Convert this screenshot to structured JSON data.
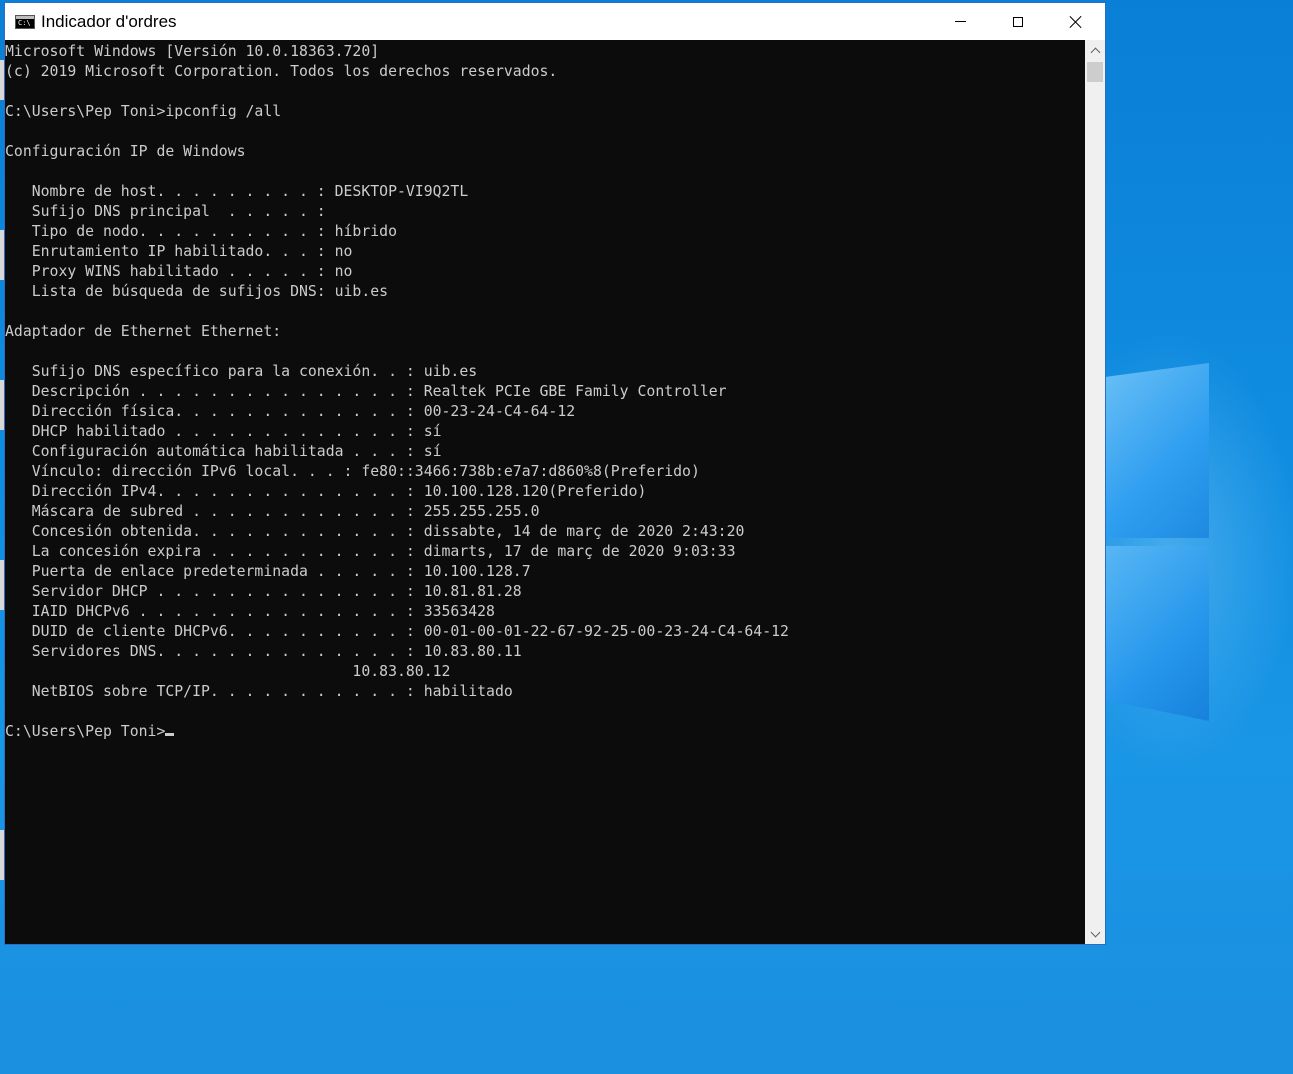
{
  "window": {
    "title": "Indicador d'ordres"
  },
  "console": {
    "lines": [
      "Microsoft Windows [Versión 10.0.18363.720]",
      "(c) 2019 Microsoft Corporation. Todos los derechos reservados.",
      "",
      "C:\\Users\\Pep Toni>ipconfig /all",
      "",
      "Configuración IP de Windows",
      "",
      "   Nombre de host. . . . . . . . . : DESKTOP-VI9Q2TL",
      "   Sufijo DNS principal  . . . . . :",
      "   Tipo de nodo. . . . . . . . . . : híbrido",
      "   Enrutamiento IP habilitado. . . : no",
      "   Proxy WINS habilitado . . . . . : no",
      "   Lista de búsqueda de sufijos DNS: uib.es",
      "",
      "Adaptador de Ethernet Ethernet:",
      "",
      "   Sufijo DNS específico para la conexión. . : uib.es",
      "   Descripción . . . . . . . . . . . . . . . : Realtek PCIe GBE Family Controller",
      "   Dirección física. . . . . . . . . . . . . : 00-23-24-C4-64-12",
      "   DHCP habilitado . . . . . . . . . . . . . : sí",
      "   Configuración automática habilitada . . . : sí",
      "   Vínculo: dirección IPv6 local. . . : fe80::3466:738b:e7a7:d860%8(Preferido)",
      "   Dirección IPv4. . . . . . . . . . . . . . : 10.100.128.120(Preferido)",
      "   Máscara de subred . . . . . . . . . . . . : 255.255.255.0",
      "   Concesión obtenida. . . . . . . . . . . . : dissabte, 14 de març de 2020 2:43:20",
      "   La concesión expira . . . . . . . . . . . : dimarts, 17 de març de 2020 9:03:33",
      "   Puerta de enlace predeterminada . . . . . : 10.100.128.7",
      "   Servidor DHCP . . . . . . . . . . . . . . : 10.81.81.28",
      "   IAID DHCPv6 . . . . . . . . . . . . . . . : 33563428",
      "   DUID de cliente DHCPv6. . . . . . . . . . : 00-01-00-01-22-67-92-25-00-23-24-C4-64-12",
      "   Servidores DNS. . . . . . . . . . . . . . : 10.83.80.11",
      "                                       10.83.80.12",
      "   NetBIOS sobre TCP/IP. . . . . . . . . . . : habilitado",
      "",
      "C:\\Users\\Pep Toni>"
    ]
  },
  "icons": {
    "app": "cmd-icon",
    "minimize": "minimize-icon",
    "maximize": "maximize-icon",
    "close": "close-icon",
    "scroll_up": "chevron-up-icon",
    "scroll_down": "chevron-down-icon"
  },
  "colors": {
    "console_bg": "#0c0c0c",
    "console_fg": "#cccccc",
    "desktop_blue": "#0f8ce0"
  }
}
